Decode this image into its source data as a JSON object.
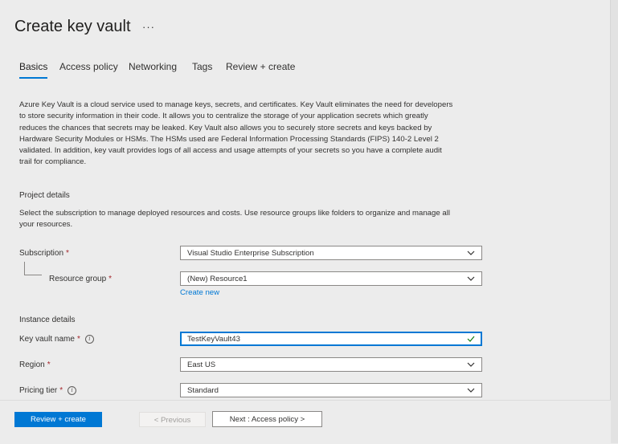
{
  "header": {
    "title": "Create key vault",
    "more": "···"
  },
  "tabs": [
    {
      "label": "Basics",
      "active": true
    },
    {
      "label": "Access policy"
    },
    {
      "label": "Networking"
    },
    {
      "label": "Tags"
    },
    {
      "label": "Review + create"
    }
  ],
  "intro": {
    "lines": [
      "Azure Key Vault is a cloud service used to manage keys, secrets, and certificates. Key Vault eliminates the need for developers",
      "to store security information in their code. It allows you to centralize the storage of your application secrets which greatly",
      "reduces the chances that secrets may be leaked. Key Vault also allows you to securely store secrets and keys backed by",
      "Hardware Security Modules or HSMs. The HSMs used are Federal Information Processing Standards (FIPS) 140-2 Level 2",
      "validated. In addition, key vault provides logs of all access and usage attempts of your secrets so you have a complete audit",
      "trail for compliance."
    ]
  },
  "project": {
    "heading": "Project details",
    "hint_lines": [
      "Select the subscription to manage deployed resources and costs. Use resource groups like folders to organize and manage all",
      "your resources."
    ],
    "subscription": {
      "label": "Subscription",
      "required": "*",
      "value": "Visual Studio Enterprise Subscription"
    },
    "resource_group": {
      "label": "Resource group",
      "required": "*",
      "value": "(New) Resource1",
      "create_new": "Create new"
    }
  },
  "instance": {
    "heading": "Instance details",
    "key_vault_name": {
      "label": "Key vault name",
      "required": "*",
      "info": "i",
      "value": "TestKeyVault43"
    },
    "region": {
      "label": "Region",
      "required": "*",
      "value": "East US"
    },
    "pricing_tier": {
      "label": "Pricing tier",
      "required": "*",
      "info": "i",
      "value": "Standard"
    }
  },
  "footer": {
    "review_create": "Review + create",
    "previous": "< Previous",
    "next": "Next : Access policy >"
  },
  "colors": {
    "accent": "#0078d4",
    "required": "#a4262c",
    "valid": "#107c10"
  }
}
